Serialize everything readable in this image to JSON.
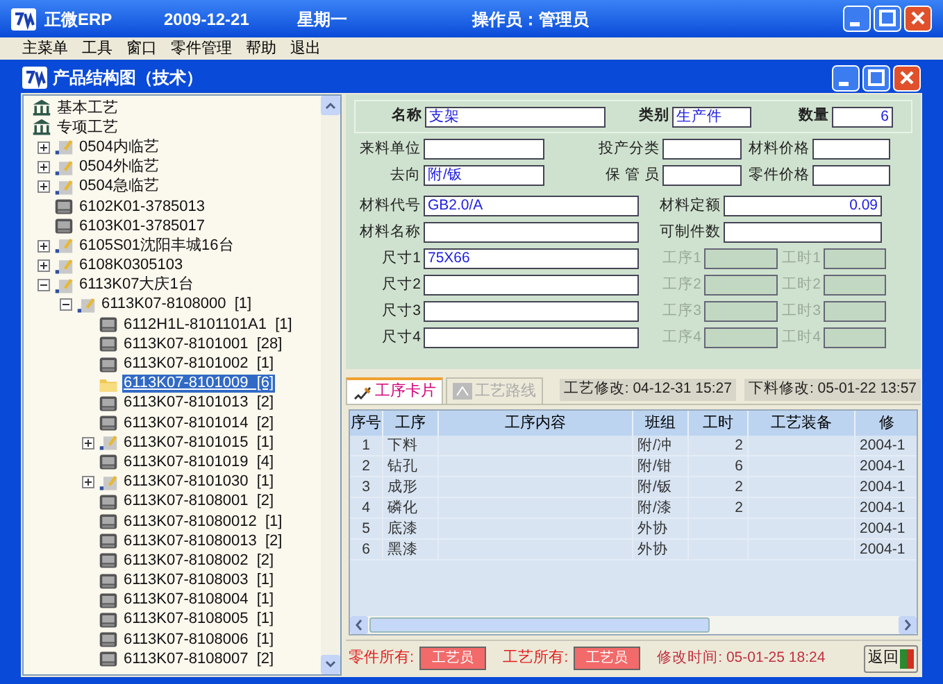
{
  "app_window": {
    "title": "正微ERP",
    "date": "2009-12-21",
    "weekday": "星期一",
    "operator": "操作员：管理员"
  },
  "menu": [
    "主菜单",
    "工具",
    "窗口",
    "零件管理",
    "帮助",
    "退出"
  ],
  "child_window": {
    "title": "产品结构图（技术）"
  },
  "tree": [
    {
      "label": "基本工艺",
      "kind": "library"
    },
    {
      "label": "专项工艺",
      "kind": "library",
      "children": [
        {
          "label": "0504内临艺",
          "kind": "group",
          "expanded": false
        },
        {
          "label": "0504外临艺",
          "kind": "group",
          "expanded": false
        },
        {
          "label": "0504急临艺",
          "kind": "group",
          "expanded": false
        },
        {
          "label": "6102K01-3785013",
          "kind": "part"
        },
        {
          "label": "6103K01-3785017",
          "kind": "part"
        },
        {
          "label": "6105S01沈阳丰城16台",
          "kind": "group",
          "expanded": false
        },
        {
          "label": "6108K0305103",
          "kind": "group",
          "expanded": false
        },
        {
          "label": "6113K07大庆1台",
          "kind": "group",
          "expanded": true,
          "children": [
            {
              "label": "6113K07-8108000",
              "count": "[1]",
              "kind": "group",
              "expanded": true,
              "children": [
                {
                  "label": "6112H1L-8101101A1",
                  "count": "[1]",
                  "kind": "part",
                  "selected": false
                },
                {
                  "label": "6113K07-8101001",
                  "count": "[28]",
                  "kind": "part",
                  "selected": false
                },
                {
                  "label": "6113K07-8101002",
                  "count": "[1]",
                  "kind": "part",
                  "selected": false
                },
                {
                  "label": "6113K07-8101009",
                  "count": "[6]",
                  "kind": "part",
                  "selected": true
                },
                {
                  "label": "6113K07-8101013",
                  "count": "[2]",
                  "kind": "part",
                  "selected": false
                },
                {
                  "label": "6113K07-8101014",
                  "count": "[2]",
                  "kind": "part",
                  "selected": false
                },
                {
                  "label": "6113K07-8101015",
                  "count": "[1]",
                  "kind": "group",
                  "expanded": false
                },
                {
                  "label": "6113K07-8101019",
                  "count": "[4]",
                  "kind": "part",
                  "selected": false
                },
                {
                  "label": "6113K07-8101030",
                  "count": "[1]",
                  "kind": "group",
                  "expanded": false
                },
                {
                  "label": "6113K07-8108001",
                  "count": "[2]",
                  "kind": "part",
                  "selected": false
                },
                {
                  "label": "6113K07-81080012",
                  "count": "[1]",
                  "kind": "part",
                  "selected": false
                },
                {
                  "label": "6113K07-81080013",
                  "count": "[2]",
                  "kind": "part",
                  "selected": false
                },
                {
                  "label": "6113K07-8108002",
                  "count": "[2]",
                  "kind": "part",
                  "selected": false
                },
                {
                  "label": "6113K07-8108003",
                  "count": "[1]",
                  "kind": "part",
                  "selected": false
                },
                {
                  "label": "6113K07-8108004",
                  "count": "[1]",
                  "kind": "part",
                  "selected": false
                },
                {
                  "label": "6113K07-8108005",
                  "count": "[1]",
                  "kind": "part",
                  "selected": false
                },
                {
                  "label": "6113K07-8108006",
                  "count": "[1]",
                  "kind": "part",
                  "selected": false
                },
                {
                  "label": "6113K07-8108007",
                  "count": "[2]",
                  "kind": "part",
                  "selected": false
                }
              ]
            }
          ]
        }
      ]
    }
  ],
  "form": {
    "header": [
      {
        "label": "名称",
        "value": "支架"
      },
      {
        "label": "类别",
        "value": "生产件"
      },
      {
        "label": "数量",
        "value": "6"
      }
    ],
    "rows": [
      [
        {
          "label": "来料单位"
        },
        {
          "label": "投产分类"
        },
        {
          "label": "材料价格"
        }
      ],
      [
        {
          "label": "去向",
          "value": "附/钣"
        },
        {
          "label": "保 管 员"
        },
        {
          "label": "零件价格"
        }
      ],
      [
        {
          "label": "材料代号",
          "value": "GB2.0/A"
        },
        {
          "label": "材料定额",
          "value": "0.09"
        }
      ],
      [
        {
          "label": "材料名称"
        },
        {
          "label": "可制件数"
        }
      ],
      [
        {
          "label": "尺寸1",
          "value": "75X66",
          "disabled": false
        },
        {
          "label": "工序1",
          "disabled": true
        },
        {
          "label": "工时1",
          "disabled": true
        }
      ],
      [
        {
          "label": "尺寸2",
          "disabled": false
        },
        {
          "label": "工序2",
          "disabled": true
        },
        {
          "label": "工时2",
          "disabled": true
        }
      ],
      [
        {
          "label": "尺寸3",
          "disabled": false
        },
        {
          "label": "工序3",
          "disabled": true
        },
        {
          "label": "工时3",
          "disabled": true
        }
      ],
      [
        {
          "label": "尺寸4",
          "disabled": false
        },
        {
          "label": "工序4",
          "disabled": true
        },
        {
          "label": "工时4",
          "disabled": true
        }
      ]
    ]
  },
  "tabs": [
    {
      "label": "工序卡片",
      "selected": true
    },
    {
      "label": "工艺路线",
      "selected": false
    }
  ],
  "modified": [
    "工艺修改: 04-12-31 15:27",
    "下料修改: 05-01-22 13:57"
  ],
  "table": {
    "columns": [
      "序号",
      "工序",
      "工序内容",
      "班组",
      "工时",
      "工艺装备",
      "修"
    ],
    "rows": [
      [
        "1",
        "下料",
        "",
        "附/冲",
        "2",
        "",
        "2004-1"
      ],
      [
        "2",
        "钻孔",
        "",
        "附/钳",
        "6",
        "",
        "2004-1"
      ],
      [
        "3",
        "成形",
        "",
        "附/钣",
        "2",
        "",
        "2004-1"
      ],
      [
        "4",
        "磷化",
        "",
        "附/漆",
        "2",
        "",
        "2004-1"
      ],
      [
        "5",
        "底漆",
        "",
        "外协",
        "",
        "",
        "2004-1"
      ],
      [
        "6",
        "黑漆",
        "",
        "外协",
        "",
        "",
        "2004-1"
      ]
    ]
  },
  "status_bar": {
    "part_owner_label": "零件所有:",
    "part_owner": "工艺员",
    "process_owner_label": "工艺所有:",
    "process_owner": "工艺员",
    "modified_time": "修改时间: 05-01-25 18:24",
    "back_button": "返回"
  }
}
